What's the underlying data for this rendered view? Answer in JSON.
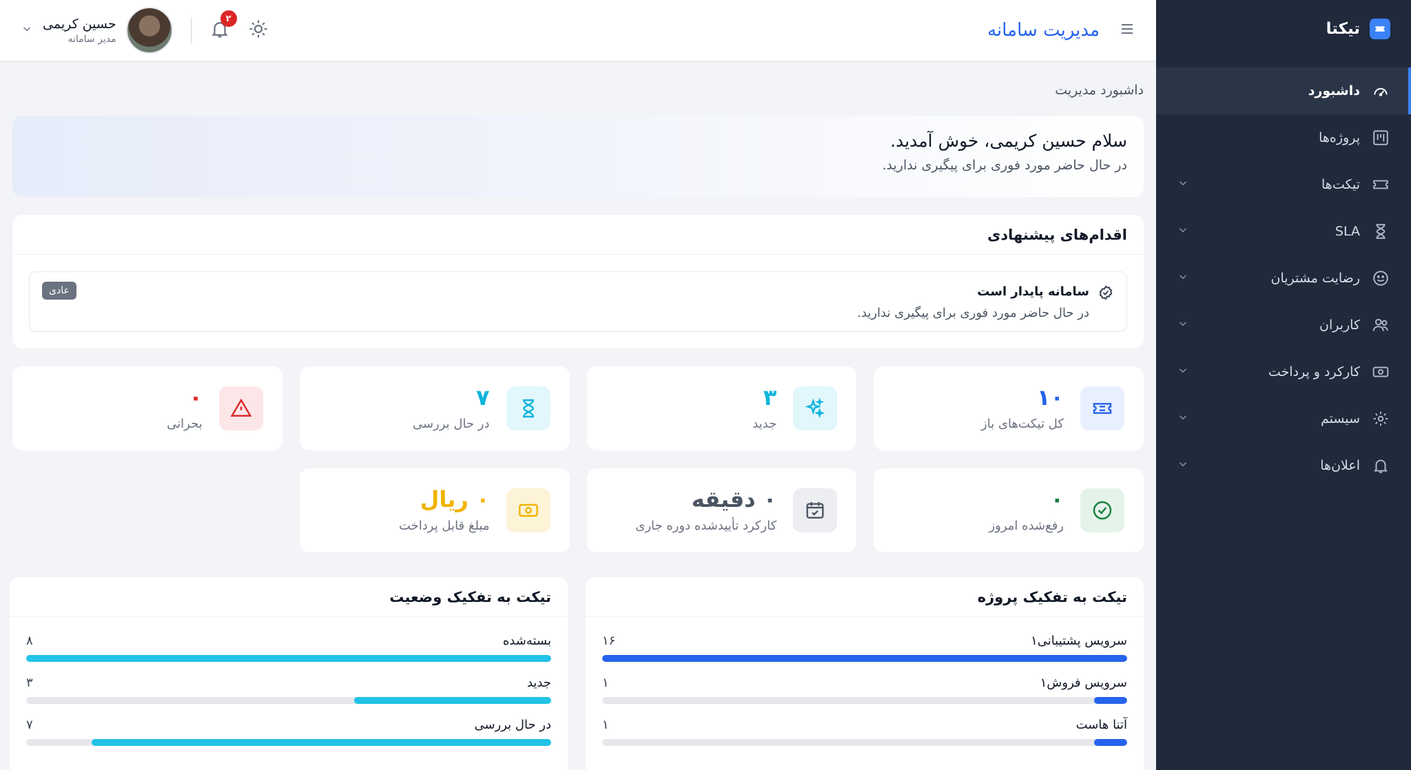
{
  "colors": {
    "accent": "#2563eb",
    "sidebar_bg": "#202a3b",
    "project_bar": "#2563eb",
    "status_bar": "#22c3e6",
    "danger": "#dc2626",
    "success": "#15803d",
    "warning": "#f0b400"
  },
  "sidebar": {
    "brand": "تیکتا",
    "items": [
      {
        "label": "داشبورد",
        "icon": "gauge-icon"
      },
      {
        "label": "پروژه‌ها",
        "icon": "kanban-icon"
      },
      {
        "label": "تیکت‌ها",
        "icon": "ticket-icon"
      },
      {
        "label": "SLA",
        "icon": "hourglass-icon"
      },
      {
        "label": "رضایت مشتریان",
        "icon": "smile-icon"
      },
      {
        "label": "کاربران",
        "icon": "users-icon"
      },
      {
        "label": "کارکرد و پرداخت",
        "icon": "cash-icon"
      },
      {
        "label": "سیستم",
        "icon": "gear-icon"
      },
      {
        "label": "اعلان‌ها",
        "icon": "bell-icon"
      }
    ]
  },
  "header": {
    "title": "مدیریت سامانه",
    "notification_count": "۲",
    "user_name": "حسین کریمی",
    "user_role": "مدیر سامانه"
  },
  "main": {
    "breadcrumb": "داشبورد مدیریت",
    "welcome_title": "سلام حسین کریمی، خوش آمدید.",
    "welcome_sub": "در حال حاضر مورد فوری برای پیگیری ندارید.",
    "actions": {
      "title": "اقدام‌های پیشنهادی",
      "item_title": "سامانه پایدار است",
      "item_sub": "در حال حاضر مورد فوری برای پیگیری ندارید.",
      "tag": "عادی"
    },
    "stats": [
      {
        "value": "۱۰",
        "label": "کل تیکت‌های باز"
      },
      {
        "value": "۳",
        "label": "جدید"
      },
      {
        "value": "۷",
        "label": "در حال بررسی"
      },
      {
        "value": "۰",
        "label": "بحرانی"
      },
      {
        "value": "۰",
        "label": "رفع‌شده امروز"
      },
      {
        "value": "۰ دقیقه",
        "label": "کارکرد تأییدشده دوره جاری"
      },
      {
        "value": "۰ ریال",
        "label": "مبلغ قابل پرداخت"
      }
    ],
    "by_project": {
      "title": "تیکت به تفکیک پروژه",
      "rows": [
        {
          "label": "سرویس پشتیبانی۱",
          "count": "۱۶",
          "fraction": 1.0
        },
        {
          "label": "سرویس فروش۱",
          "count": "۱",
          "fraction": 0.0625
        },
        {
          "label": "آتنا هاست",
          "count": "۱",
          "fraction": 0.0625
        }
      ]
    },
    "by_status": {
      "title": "تیکت به تفکیک وضعیت",
      "rows": [
        {
          "label": "بسته‌شده",
          "count": "۸",
          "fraction": 1.0
        },
        {
          "label": "جدید",
          "count": "۳",
          "fraction": 0.375
        },
        {
          "label": "در حال بررسی",
          "count": "۷",
          "fraction": 0.875
        }
      ]
    }
  }
}
